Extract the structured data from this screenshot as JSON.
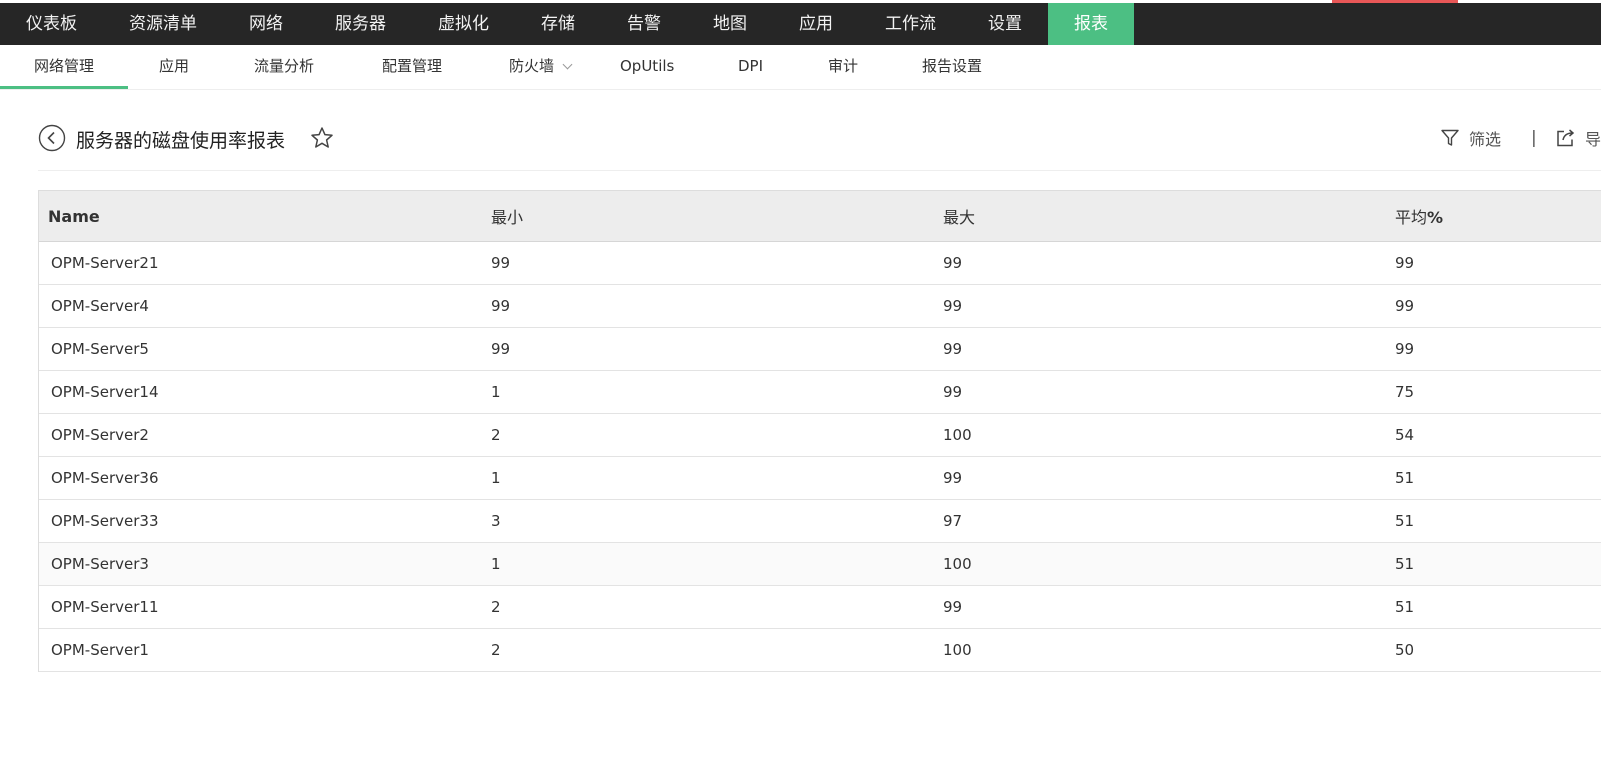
{
  "colors": {
    "nav_bg": "#262626",
    "active_tab": "#4cbf83",
    "accent_red": "#e85757"
  },
  "topnav": {
    "items": [
      {
        "label": "仪表板"
      },
      {
        "label": "资源清单"
      },
      {
        "label": "网络"
      },
      {
        "label": "服务器"
      },
      {
        "label": "虚拟化"
      },
      {
        "label": "存储"
      },
      {
        "label": "告警"
      },
      {
        "label": "地图"
      },
      {
        "label": "应用"
      },
      {
        "label": "工作流"
      },
      {
        "label": "设置"
      },
      {
        "label": "报表",
        "active": true
      }
    ]
  },
  "subnav": {
    "items": [
      {
        "label": "网络管理",
        "active": true
      },
      {
        "label": "应用"
      },
      {
        "label": "流量分析"
      },
      {
        "label": "配置管理"
      },
      {
        "label": "防火墙",
        "has_dropdown": true
      },
      {
        "label": "OpUtils"
      },
      {
        "label": "DPI"
      },
      {
        "label": "审计"
      },
      {
        "label": "报告设置"
      }
    ]
  },
  "report": {
    "title": "服务器的磁盘使用率报表",
    "filter_label": "筛选",
    "separator": "|",
    "export_label": "导",
    "icons": [
      "back-circle-icon",
      "star-outline-icon",
      "filter-funnel-icon",
      "export-share-icon"
    ]
  },
  "table": {
    "headers": {
      "name": "Name",
      "min": "最小",
      "max": "最大",
      "avg": "平均",
      "avg_unit": "%"
    },
    "rows": [
      {
        "name": "OPM-Server21",
        "min": "99",
        "max": "99",
        "avg": "99"
      },
      {
        "name": "OPM-Server4",
        "min": "99",
        "max": "99",
        "avg": "99"
      },
      {
        "name": "OPM-Server5",
        "min": "99",
        "max": "99",
        "avg": "99"
      },
      {
        "name": "OPM-Server14",
        "min": "1",
        "max": "99",
        "avg": "75"
      },
      {
        "name": "OPM-Server2",
        "min": "2",
        "max": "100",
        "avg": "54"
      },
      {
        "name": "OPM-Server36",
        "min": "1",
        "max": "99",
        "avg": "51"
      },
      {
        "name": "OPM-Server33",
        "min": "3",
        "max": "97",
        "avg": "51"
      },
      {
        "name": "OPM-Server3",
        "min": "1",
        "max": "100",
        "avg": "51"
      },
      {
        "name": "OPM-Server11",
        "min": "2",
        "max": "99",
        "avg": "51"
      },
      {
        "name": "OPM-Server1",
        "min": "2",
        "max": "100",
        "avg": "50"
      }
    ]
  }
}
